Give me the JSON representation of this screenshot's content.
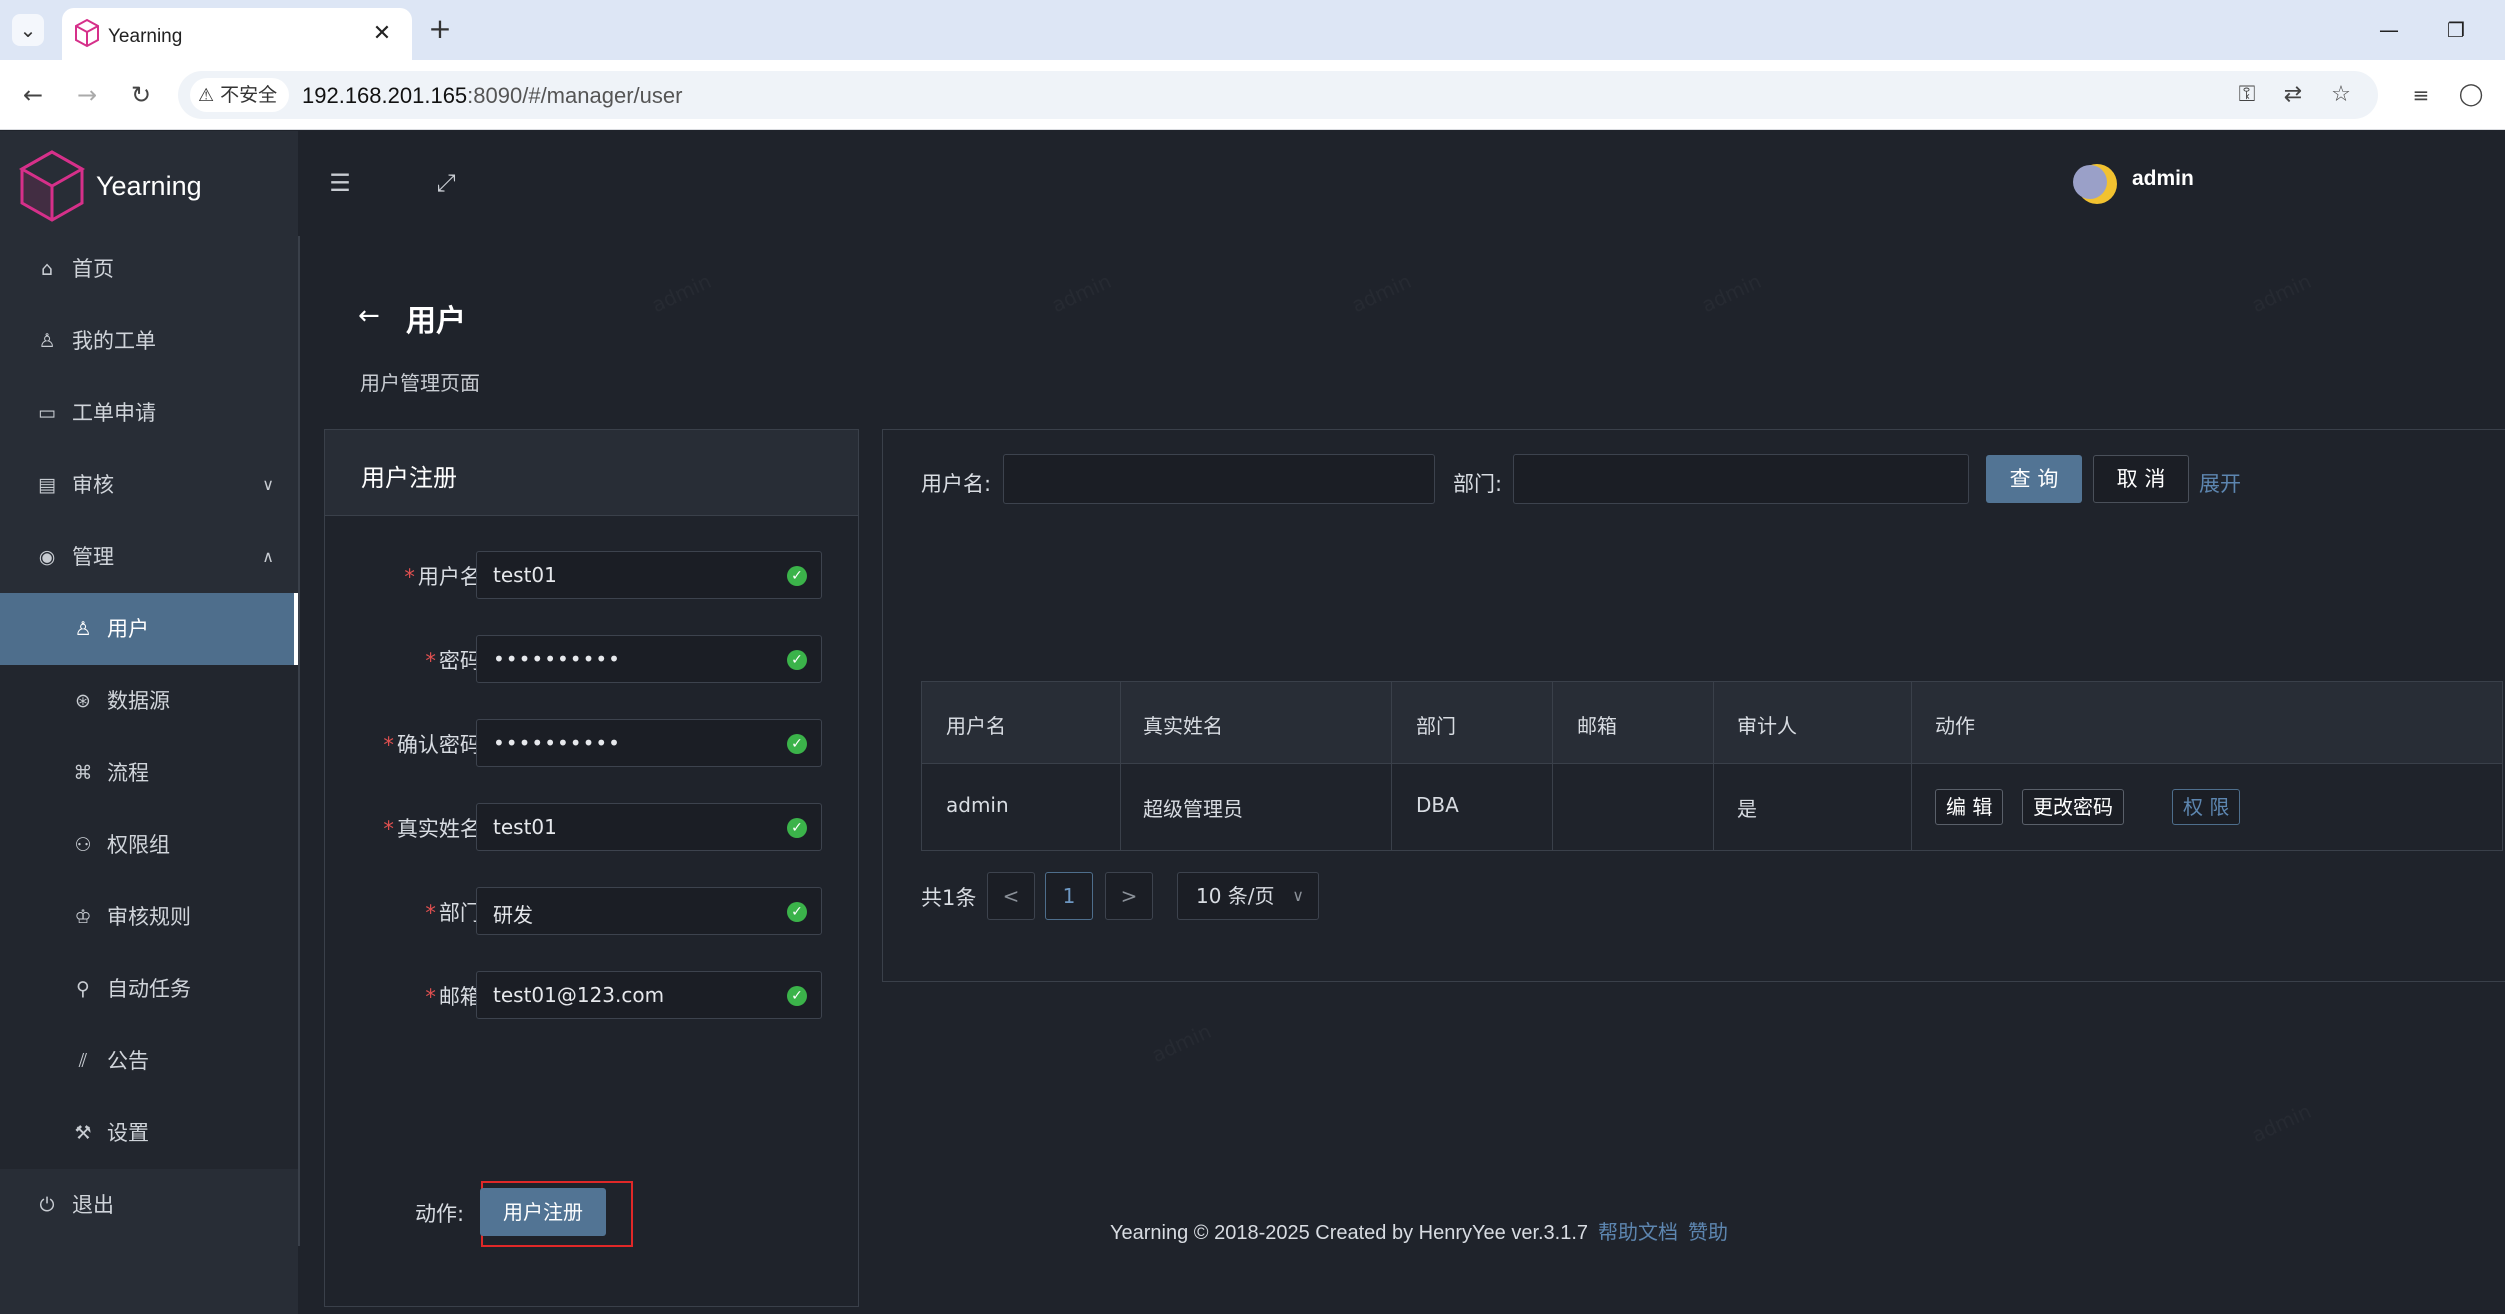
{
  "browser": {
    "tab_title": "Yearning",
    "insecure_label": "不安全",
    "url_host": "192.168.201.165",
    "url_path": ":8090/#/manager/user"
  },
  "app": {
    "brand": "Yearning",
    "username": "admin"
  },
  "sidebar": {
    "items": [
      {
        "label": "首页",
        "icon": "home-icon"
      },
      {
        "label": "我的工单",
        "icon": "user-icon"
      },
      {
        "label": "工单申请",
        "icon": "monitor-icon"
      },
      {
        "label": "审核",
        "icon": "audit-icon"
      },
      {
        "label": "管理",
        "icon": "manage-icon"
      }
    ],
    "manage_items": [
      {
        "label": "用户",
        "icon": "user-icon",
        "active": true
      },
      {
        "label": "数据源",
        "icon": "datasource-icon"
      },
      {
        "label": "流程",
        "icon": "flow-icon"
      },
      {
        "label": "权限组",
        "icon": "permission-group-icon"
      },
      {
        "label": "审核规则",
        "icon": "rules-icon"
      },
      {
        "label": "自动任务",
        "icon": "attach-icon"
      },
      {
        "label": "公告",
        "icon": "chart-icon"
      },
      {
        "label": "设置",
        "icon": "wrench-icon"
      }
    ],
    "logout": "退出"
  },
  "page": {
    "title": "用户",
    "description": "用户管理页面"
  },
  "register": {
    "title": "用户注册",
    "fields": [
      {
        "label": "用户名:",
        "value": "test01"
      },
      {
        "label": "密码:",
        "value": "••••••••••"
      },
      {
        "label": "确认密码:",
        "value": "••••••••••"
      },
      {
        "label": "真实姓名:",
        "value": "test01"
      },
      {
        "label": "部门:",
        "value": "研发"
      },
      {
        "label": "邮箱:",
        "value": "test01@123.com"
      }
    ],
    "action_label": "动作:",
    "submit_label": "用户注册"
  },
  "query": {
    "username_label": "用户名:",
    "dept_label": "部门:",
    "query_button": "查 询",
    "cancel_button": "取 消",
    "expand_link": "展开"
  },
  "table": {
    "headers": [
      "用户名",
      "真实姓名",
      "部门",
      "邮箱",
      "审计人",
      "动作"
    ],
    "rows": [
      {
        "username": "admin",
        "realname": "超级管理员",
        "dept": "DBA",
        "email": "",
        "auditor": "是"
      }
    ],
    "actions": {
      "edit": "编 辑",
      "change_password": "更改密码",
      "permission": "权 限"
    }
  },
  "pagination": {
    "total": "共1条",
    "current": "1",
    "page_size": "10 条/页"
  },
  "footer": {
    "text": "Yearning © 2018-2025 Created by HenryYee ver.3.1.7",
    "help_link": "帮助文档",
    "sponsor_link": "赞助"
  },
  "watermark": "admin"
}
